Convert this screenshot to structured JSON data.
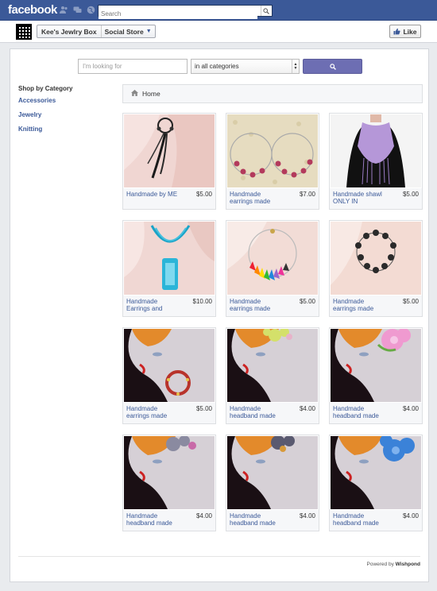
{
  "fbbar": {
    "logo": "facebook",
    "search_placeholder": "Search"
  },
  "page": {
    "name": "Kee's Jewlry Box",
    "tab": "Social Store",
    "like_label": "Like"
  },
  "search": {
    "placeholder": "I'm looking for",
    "category": "in all categories"
  },
  "sidebar": {
    "heading": "Shop by Category",
    "items": [
      "Accessories",
      "Jewelry",
      "Knitting"
    ]
  },
  "breadcrumb": {
    "home": "Home"
  },
  "products": [
    {
      "title": "Handmade by ME",
      "price": "$5.00"
    },
    {
      "title": "Handmade earrings made",
      "price": "$7.00"
    },
    {
      "title": "Handmade shawl ONLY IN",
      "price": "$5.00"
    },
    {
      "title": "Handmade Earrings and",
      "price": "$10.00"
    },
    {
      "title": "Handmade earrings made",
      "price": "$5.00"
    },
    {
      "title": "Handmade earrings made",
      "price": "$5.00"
    },
    {
      "title": "Handmade earrings made",
      "price": "$5.00"
    },
    {
      "title": "Handmade headband made",
      "price": "$4.00"
    },
    {
      "title": "Handmade headband made",
      "price": "$4.00"
    },
    {
      "title": "Handmade headband made",
      "price": "$4.00"
    },
    {
      "title": "Handmade headband made",
      "price": "$4.00"
    },
    {
      "title": "Handmade headband made",
      "price": "$4.00"
    }
  ],
  "footer": {
    "powered_prefix": "Powered by",
    "powered_brand": "Wishpond"
  },
  "colors": {
    "fb_blue": "#3b5998",
    "button_purple": "#6d6eb3"
  }
}
